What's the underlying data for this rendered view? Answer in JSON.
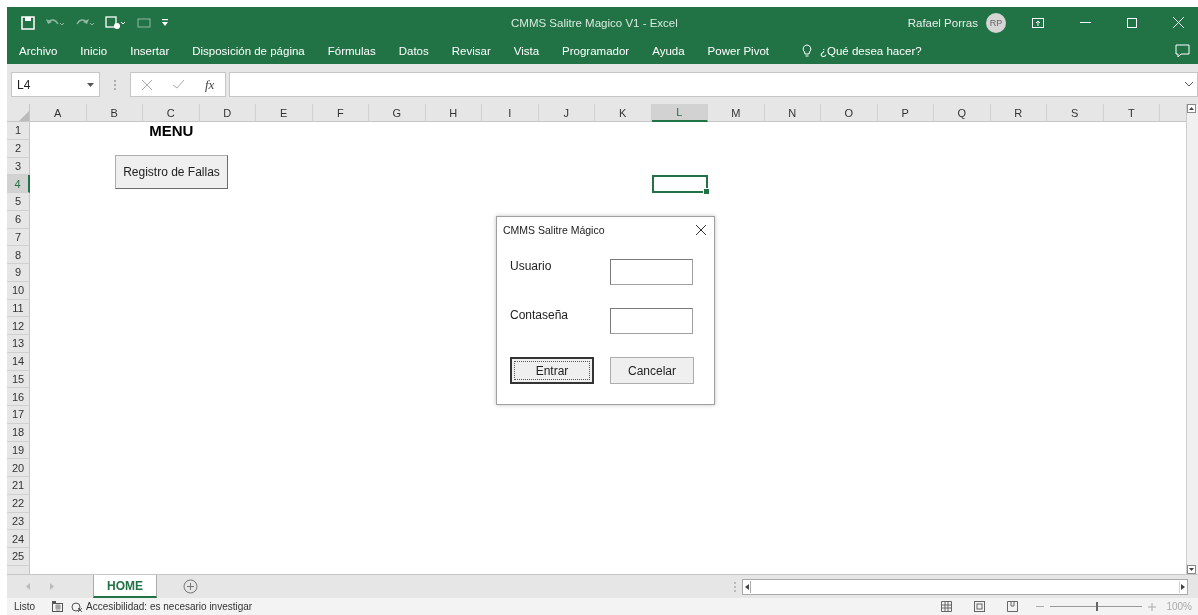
{
  "window": {
    "title": "CMMS Salitre Magico V1  -  Excel",
    "user": "Rafael Porras",
    "initials": "RP"
  },
  "ribbon_tabs": [
    {
      "label": "Archivo"
    },
    {
      "label": "Inicio"
    },
    {
      "label": "Insertar"
    },
    {
      "label": "Disposición de página"
    },
    {
      "label": "Fórmulas"
    },
    {
      "label": "Datos"
    },
    {
      "label": "Revisar"
    },
    {
      "label": "Vista"
    },
    {
      "label": "Programador"
    },
    {
      "label": "Ayuda"
    },
    {
      "label": "Power Pivot"
    }
  ],
  "tell_me": "¿Qué desea hacer?",
  "formula_bar": {
    "name_box": "L4",
    "fx": "fx"
  },
  "columns": [
    {
      "label": "A",
      "selected": false
    },
    {
      "label": "B",
      "selected": false
    },
    {
      "label": "C",
      "selected": false
    },
    {
      "label": "D",
      "selected": false
    },
    {
      "label": "E",
      "selected": false
    },
    {
      "label": "F",
      "selected": false
    },
    {
      "label": "G",
      "selected": false
    },
    {
      "label": "H",
      "selected": false
    },
    {
      "label": "I",
      "selected": false
    },
    {
      "label": "J",
      "selected": false
    },
    {
      "label": "K",
      "selected": false
    },
    {
      "label": "L",
      "selected": true
    },
    {
      "label": "M",
      "selected": false
    },
    {
      "label": "N",
      "selected": false
    },
    {
      "label": "O",
      "selected": false
    },
    {
      "label": "P",
      "selected": false
    },
    {
      "label": "Q",
      "selected": false
    },
    {
      "label": "R",
      "selected": false
    },
    {
      "label": "S",
      "selected": false
    },
    {
      "label": "T",
      "selected": false
    }
  ],
  "rows": [
    {
      "label": "1",
      "selected": false
    },
    {
      "label": "2",
      "selected": false
    },
    {
      "label": "3",
      "selected": false
    },
    {
      "label": "4",
      "selected": true
    },
    {
      "label": "5",
      "selected": false
    },
    {
      "label": "6",
      "selected": false
    },
    {
      "label": "7",
      "selected": false
    },
    {
      "label": "8",
      "selected": false
    },
    {
      "label": "9",
      "selected": false
    },
    {
      "label": "10",
      "selected": false
    },
    {
      "label": "11",
      "selected": false
    },
    {
      "label": "12",
      "selected": false
    },
    {
      "label": "13",
      "selected": false
    },
    {
      "label": "14",
      "selected": false
    },
    {
      "label": "15",
      "selected": false
    },
    {
      "label": "16",
      "selected": false
    },
    {
      "label": "17",
      "selected": false
    },
    {
      "label": "18",
      "selected": false
    },
    {
      "label": "19",
      "selected": false
    },
    {
      "label": "20",
      "selected": false
    },
    {
      "label": "21",
      "selected": false
    },
    {
      "label": "22",
      "selected": false
    },
    {
      "label": "23",
      "selected": false
    },
    {
      "label": "24",
      "selected": false
    },
    {
      "label": "25",
      "selected": false
    }
  ],
  "sheet": {
    "heading": "MENU",
    "button": "Registro de Fallas"
  },
  "dialog": {
    "title": "CMMS Salitre Mágico",
    "fields": [
      {
        "label": "Usuario"
      },
      {
        "label": "Contaseña"
      }
    ],
    "buttons": [
      {
        "label": "Entrar",
        "focused": true
      },
      {
        "label": "Cancelar",
        "focused": false
      }
    ]
  },
  "sheet_tabs": [
    {
      "label": "HOME",
      "selected": true
    }
  ],
  "status_bar": {
    "mode": "Listo",
    "accessibility": "Accesibilidad: es necesario investigar",
    "zoom": "100%",
    "zoom_slider": {
      "level": 0.5
    }
  }
}
